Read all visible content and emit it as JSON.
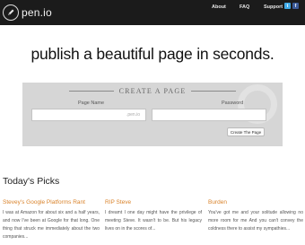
{
  "header": {
    "brand": "pen.io",
    "nav": {
      "about": "About",
      "faq": "FAQ",
      "support": "Support"
    },
    "social": {
      "twitter": "t",
      "facebook": "f"
    }
  },
  "hero": {
    "tagline": "publish a beautiful page in seconds."
  },
  "create": {
    "title": "CREATE A PAGE",
    "page_name_label": "Page Name",
    "password_label": "Password",
    "page_name_value": "",
    "password_value": "",
    "page_suffix": ".pen.io",
    "button": "Create The Page"
  },
  "picks": {
    "heading": "Today's Picks",
    "items": [
      {
        "title": "Stevey's Google Platforms Rant",
        "excerpt": "I was at Amazon for about six and a half years, and now I've been at Google for that long. One thing that struck me immediately about the two companies..."
      },
      {
        "title": "RIP Steve",
        "excerpt": "I dreamt I one day might have the privilege of meeting Steve. It wasn't to be. But his legacy lives on in the scores of..."
      },
      {
        "title": "Burden",
        "excerpt": "You've got me and your solitude allowing no more room for me And you can't convey the coldness there to assist my sympathies..."
      }
    ]
  },
  "colors": {
    "topbar": "#1b1b1b",
    "panel": "#d6d6d6",
    "pick_title": "#d9832b",
    "twitter": "#3fa9e6",
    "facebook": "#3b5a98"
  }
}
